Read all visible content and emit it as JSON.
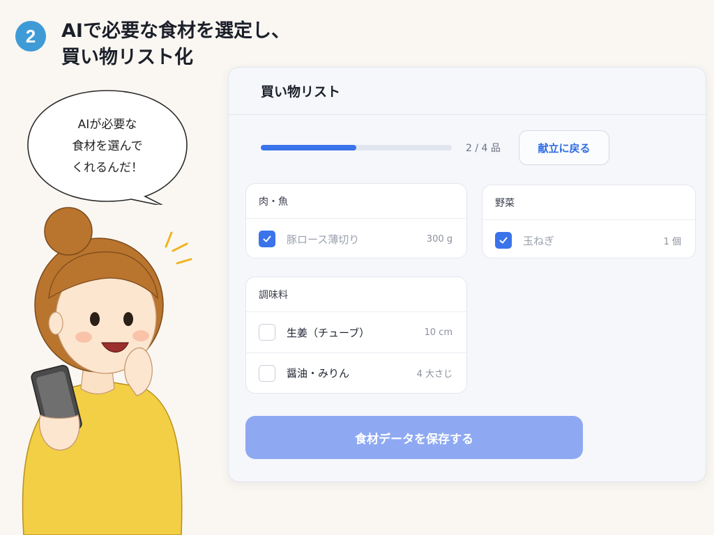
{
  "step": {
    "number": "2",
    "title_line1": "AIで必要な食材を選定し、",
    "title_line2": "買い物リスト化"
  },
  "speech_bubble": {
    "line1": "AIが必要な",
    "line2": "食材を選んで",
    "line3": "くれるんだ！"
  },
  "panel": {
    "title": "買い物リスト",
    "progress": {
      "label": "2 / 4 品",
      "fraction": 0.5
    },
    "back_button_label": "献立に戻る",
    "categories": [
      {
        "name": "肉・魚",
        "items": [
          {
            "name": "豚ロース薄切り",
            "qty": "300 g",
            "checked": true
          }
        ]
      },
      {
        "name": "野菜",
        "items": [
          {
            "name": "玉ねぎ",
            "qty": "1 個",
            "checked": true
          }
        ]
      },
      {
        "name": "調味料",
        "items": [
          {
            "name": "生姜（チューブ）",
            "qty": "10 cm",
            "checked": false
          },
          {
            "name": "醤油・みりん",
            "qty": "4 大さじ",
            "checked": false
          }
        ]
      }
    ],
    "save_button_label": "食材データを保存する"
  },
  "colors": {
    "accent": "#3b73ea",
    "badge": "#3f9bd6",
    "save_button": "#8ea9f2"
  }
}
